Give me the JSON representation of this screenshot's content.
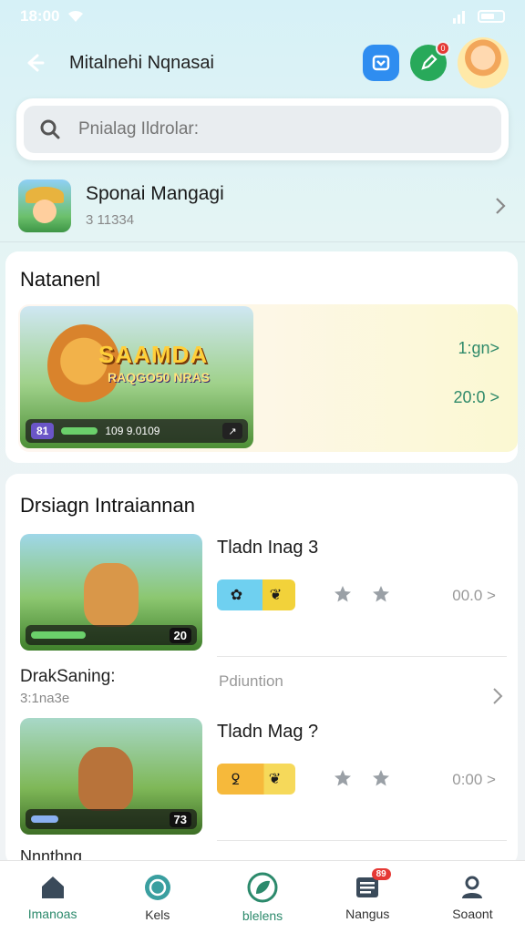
{
  "status_bar": {
    "time": "18:00"
  },
  "header": {
    "title": "Mitalnehi Nqnasai"
  },
  "search": {
    "placeholder": "Pnialag Ildrolar:"
  },
  "profile": {
    "name": "Sponai Mangagi",
    "sub": "3 11334"
  },
  "featured": {
    "title": "Natanenl",
    "banner_title": "SAAMDA",
    "banner_subtitle": "RAQGO50 NRAS",
    "banner_level": "81",
    "banner_stats": "109 9.0109",
    "stat1": "1:gn>",
    "stat2": "20:0 >"
  },
  "design": {
    "title": "Drsiagn Intraiannan",
    "items": [
      {
        "name": "Tladn Inag 3",
        "thumb_count": "20",
        "score": "00.0 >"
      },
      {
        "name": "Tladn Mag ?",
        "thumb_count": "73",
        "score": "0:00 >"
      }
    ],
    "label_row": {
      "left": "DrakSaning:",
      "left_sub": "3:1na3e",
      "mid": "Pdiuntion"
    },
    "cut_text": "Nnnthng"
  },
  "bottom_nav": [
    {
      "label": "Imanoas",
      "icon": "home-icon"
    },
    {
      "label": "Kels",
      "icon": "compass-icon"
    },
    {
      "label": "blelens",
      "icon": "leaf-icon"
    },
    {
      "label": "Nangus",
      "icon": "list-icon",
      "badge": "89"
    },
    {
      "label": "Soaont",
      "icon": "person-icon"
    }
  ]
}
